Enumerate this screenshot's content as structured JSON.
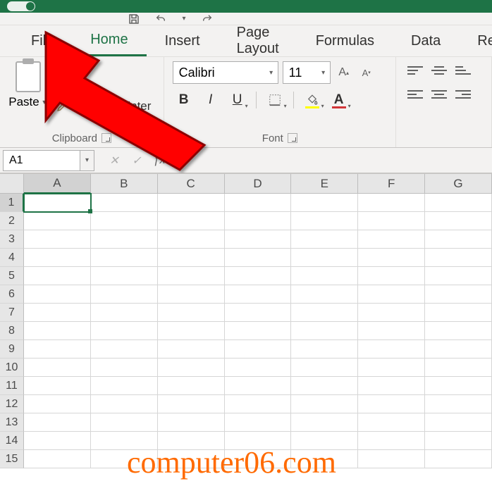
{
  "tabs": [
    "File",
    "Home",
    "Insert",
    "Page Layout",
    "Formulas",
    "Data",
    "Review"
  ],
  "activeTab": "Home",
  "clipboard": {
    "paste": "Paste",
    "format_painter": "Format Painter",
    "label": "Clipboard"
  },
  "font": {
    "name": "Calibri",
    "size": "11",
    "bold": "B",
    "italic": "I",
    "underline": "U",
    "label": "Font"
  },
  "nameBox": "A1",
  "columns": [
    "A",
    "B",
    "C",
    "D",
    "E",
    "F",
    "G"
  ],
  "rows": [
    "1",
    "2",
    "3",
    "4",
    "5",
    "6",
    "7",
    "8",
    "9",
    "10",
    "11",
    "12",
    "13",
    "14",
    "15"
  ],
  "activeCell": "A1",
  "watermark": "computer06.com"
}
